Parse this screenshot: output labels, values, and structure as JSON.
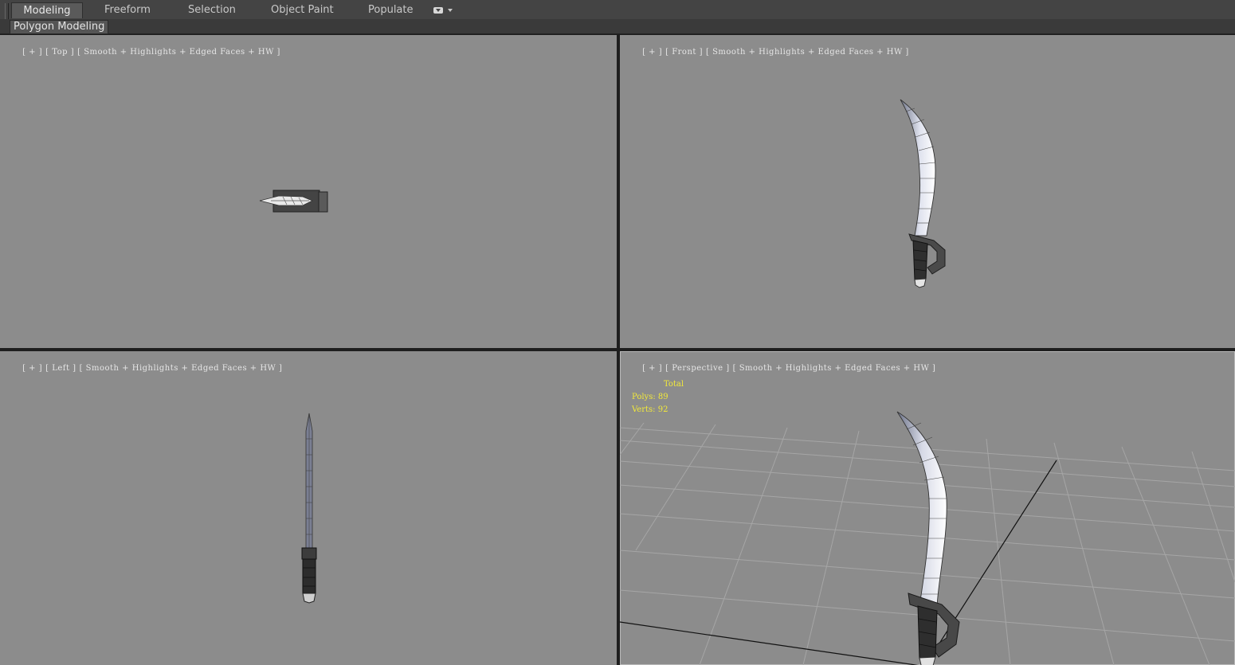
{
  "ribbon": {
    "tabs": [
      {
        "label": "Modeling",
        "active": true
      },
      {
        "label": "Freeform",
        "active": false
      },
      {
        "label": "Selection",
        "active": false
      },
      {
        "label": "Object Paint",
        "active": false
      },
      {
        "label": "Populate",
        "active": false
      }
    ],
    "panel_label": "Polygon Modeling"
  },
  "viewports": {
    "top": {
      "plus": "[ + ]",
      "view": "[ Top ]",
      "shading": "[ Smooth + Highlights + Edged Faces + HW ]"
    },
    "front": {
      "plus": "[ + ]",
      "view": "[ Front ]",
      "shading": "[ Smooth + Highlights + Edged Faces + HW ]"
    },
    "left": {
      "plus": "[ + ]",
      "view": "[ Left ]",
      "shading": "[ Smooth + Highlights + Edged Faces + HW ]"
    },
    "perspective": {
      "plus": "[ + ]",
      "view": "[ Perspective ]",
      "shading": "[ Smooth + Highlights + Edged Faces + HW ]"
    }
  },
  "stats": {
    "title": "Total",
    "polys": "Polys: 89",
    "verts": "Verts: 92"
  },
  "colors": {
    "viewport_bg": "#8c8c8c",
    "ui_bg": "#444444",
    "stats_text": "#f2e93a",
    "label_text": "#e6e6e6"
  }
}
